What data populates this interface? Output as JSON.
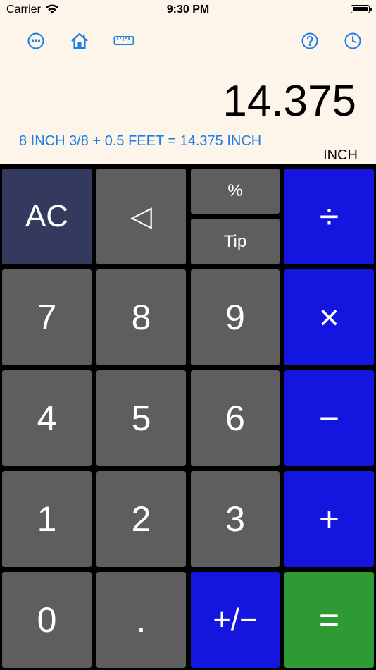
{
  "status_bar": {
    "carrier": "Carrier",
    "time": "9:30 PM",
    "icons": [
      "wifi-icon",
      "battery-icon"
    ]
  },
  "toolbar": {
    "icons": [
      "more-icon",
      "home-icon",
      "ruler-icon",
      "help-icon",
      "history-icon"
    ],
    "accent_color": "#1b7ee8"
  },
  "display": {
    "value": "14.375",
    "expression": "8 INCH 3/8 + 0.5 FEET = 14.375 INCH",
    "unit": "INCH"
  },
  "keypad": {
    "ac": "AC",
    "backspace": "◁",
    "percent": "%",
    "tip": "Tip",
    "divide": "÷",
    "multiply": "×",
    "subtract": "−",
    "add": "+",
    "equals": "=",
    "plus_minus": "+/−",
    "decimal": ".",
    "digits": {
      "d0": "0",
      "d1": "1",
      "d2": "2",
      "d3": "3",
      "d4": "4",
      "d5": "5",
      "d6": "6",
      "d7": "7",
      "d8": "8",
      "d9": "9"
    }
  },
  "colors": {
    "top_background": "#fdf5e9",
    "digit_key": "#5e5e5e",
    "clear_key": "#343a5e",
    "operator_key": "#1515e0",
    "equals_key": "#2f9a33"
  }
}
